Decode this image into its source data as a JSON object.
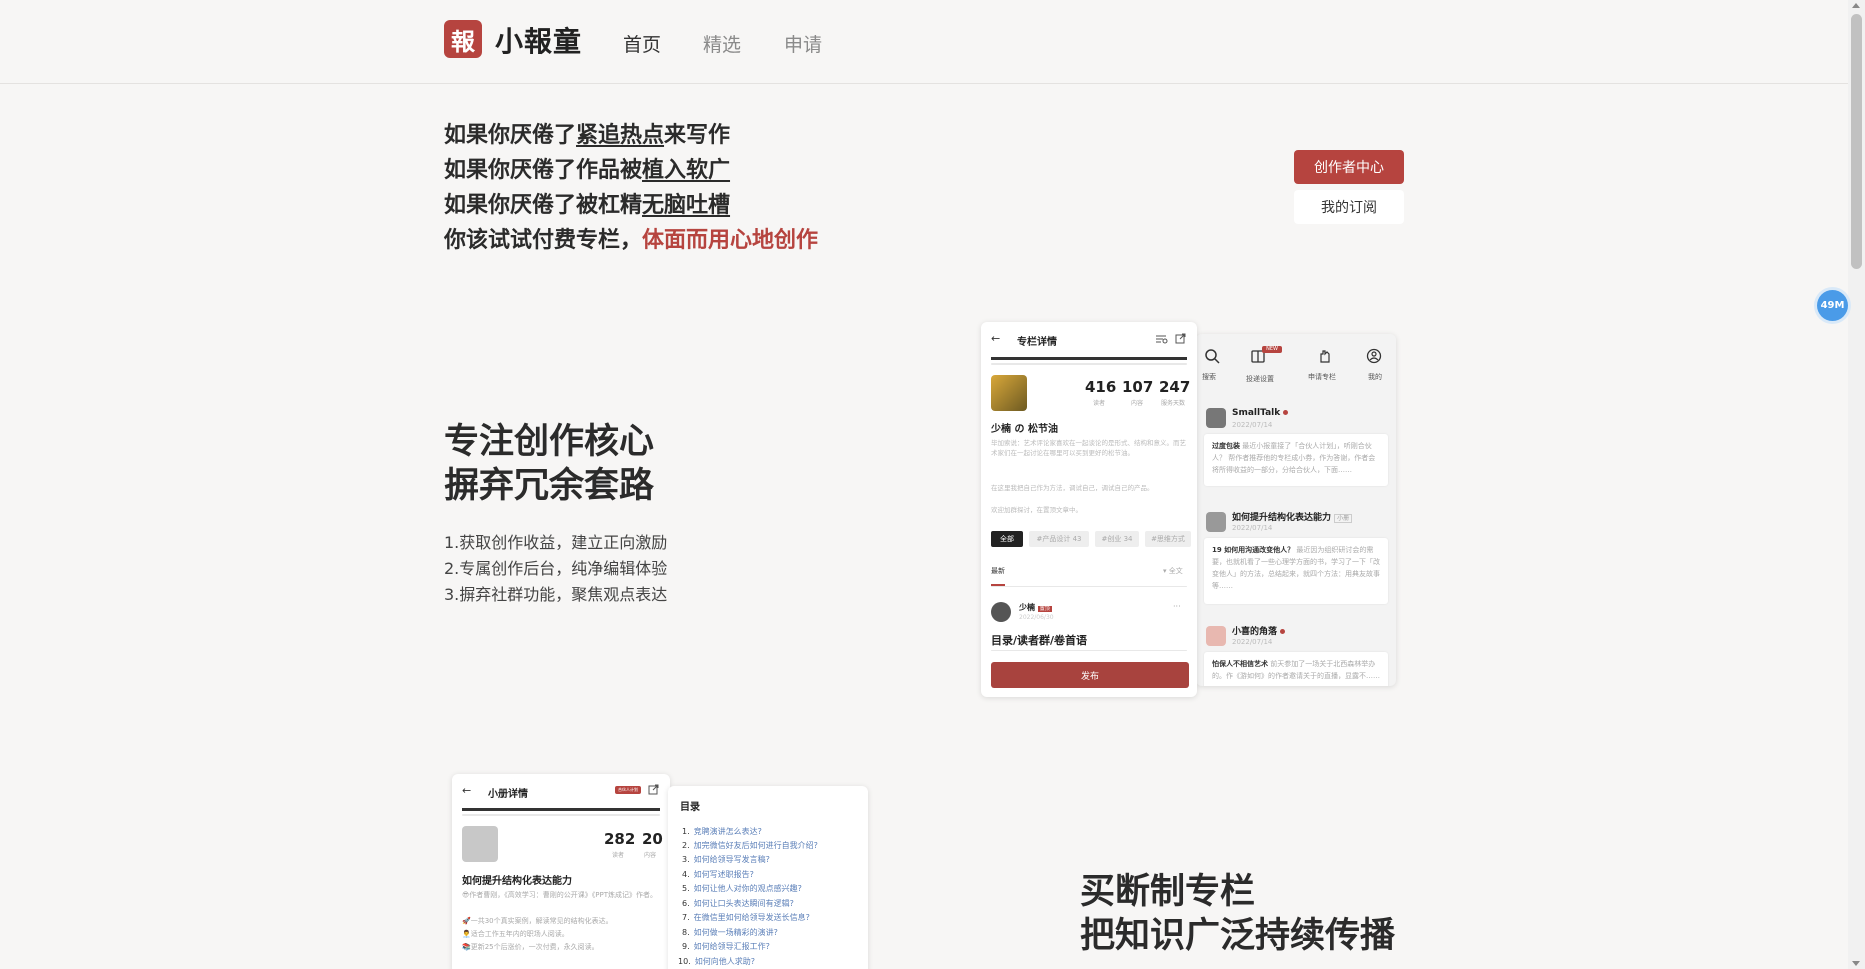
{
  "header": {
    "logo_char": "報",
    "logo_text": "小報童",
    "nav": [
      "首页",
      "精选",
      "申请"
    ]
  },
  "hero": {
    "lines": [
      {
        "pre": "如果你厌倦了",
        "u": "紧追热点",
        "post": "来写作"
      },
      {
        "pre": "如果你厌倦了作品被",
        "u": "植入软广",
        "post": ""
      },
      {
        "pre": "如果你厌倦了被杠精",
        "u": "无脑吐槽",
        "post": ""
      }
    ],
    "last_pre": "你该试试付费专栏，",
    "last_red": "体面而用心地创作",
    "btn_creator": "创作者中心",
    "btn_sub": "我的订阅",
    "badge": "49M"
  },
  "section1": {
    "title1": "专注创作核心",
    "title2": "摒弃冗余套路",
    "items": [
      "1.获取创作收益，建立正向激励",
      "2.专属创作后台，纯净编辑体验",
      "3.摒弃社群功能，聚焦观点表达"
    ]
  },
  "section2": {
    "title1": "买断制专栏",
    "title2": "把知识广泛持续传播"
  },
  "phone1": {
    "back": "←",
    "title": "专栏详情",
    "stats": [
      {
        "n": "416",
        "l": "读者"
      },
      {
        "n": "107",
        "l": "内容"
      },
      {
        "n": "247",
        "l": "服务天数"
      }
    ],
    "name": "少楠 の 松节油",
    "desc1": "毕加索说：艺术评论家喜欢在一起谈论的是形式、结构和意义。而艺术家们在一起讨论在哪里可以买到更好的松节油。",
    "desc2": "在这里我把自己作为方法，调试自己，调试自己的产品。",
    "desc3": "欢迎加群探讨，在置顶文章中。",
    "tags": [
      "全部",
      "#产品设计 43",
      "#创业 34",
      "#思维方式"
    ],
    "latest": "最新",
    "all": "全文",
    "author": "少楠",
    "author_tag": "置顶",
    "date": "2022/06/30",
    "post_title": "目录/读者群/卷首语",
    "publish": "发布",
    "more": "···"
  },
  "phone2": {
    "icons": [
      "搜索",
      "投递设置",
      "申请专栏",
      "我的"
    ],
    "new_badge": "NEW",
    "items": [
      {
        "name": "SmallTalk",
        "date": "2022/07/14",
        "bold": "过度包装",
        "text": "最近小报童接了「合伙人计划」，听刚合伙人？ 帮作者推荐他的专栏成小券，作为答谢，作者会将所得收益的一部分，分给合伙人，下面……"
      },
      {
        "name": "如何提升结构化表达能力",
        "tag": "小册",
        "date": "2022/07/14",
        "bold": "19 如何用沟通改变他人？",
        "text": "最近因为组织研讨会的需要，也就机看了一些心理学方面的书，学习了一下「改变他人」的方法，总结起来，就四个方法：用典友故事等……"
      },
      {
        "name": "小喜的角落",
        "date": "2022/07/14",
        "bold": "怕保人不相信艺术",
        "text": "前天参加了一场关于北西森林举办的。作《游如何》的作者邀请关于的直播，显露不……"
      }
    ]
  },
  "phone3": {
    "title": "小册详情",
    "tag": "合伙人计划",
    "stats": [
      {
        "n": "282",
        "l": "读者"
      },
      {
        "n": "20",
        "l": "内容"
      }
    ],
    "name": "如何提升结构化表达能力",
    "lines": [
      "😎作者曹刚，《高效学习：曹刚的公开课》《PPT炼成记》作者。",
      "🚀一共30个真实案例，解读常见的结构化表达。",
      "👨‍💼适合工作五年内的职场人阅读。",
      "📚更新25个后涨价，一次付费，永久阅读。"
    ]
  },
  "toc": {
    "title": "目录",
    "items": [
      "竞聘演讲怎么表达?",
      "加完微信好友后如何进行自我介绍?",
      "如何给领导写发言稿?",
      "如何写述职报告?",
      "如何让他人对你的观点感兴趣?",
      "如何让口头表达瞬间有逻辑?",
      "在微信里如何给领导发送长信息?",
      "如何做一场精彩的演讲?",
      "如何给领导汇报工作?",
      "如何向他人求助?"
    ]
  }
}
